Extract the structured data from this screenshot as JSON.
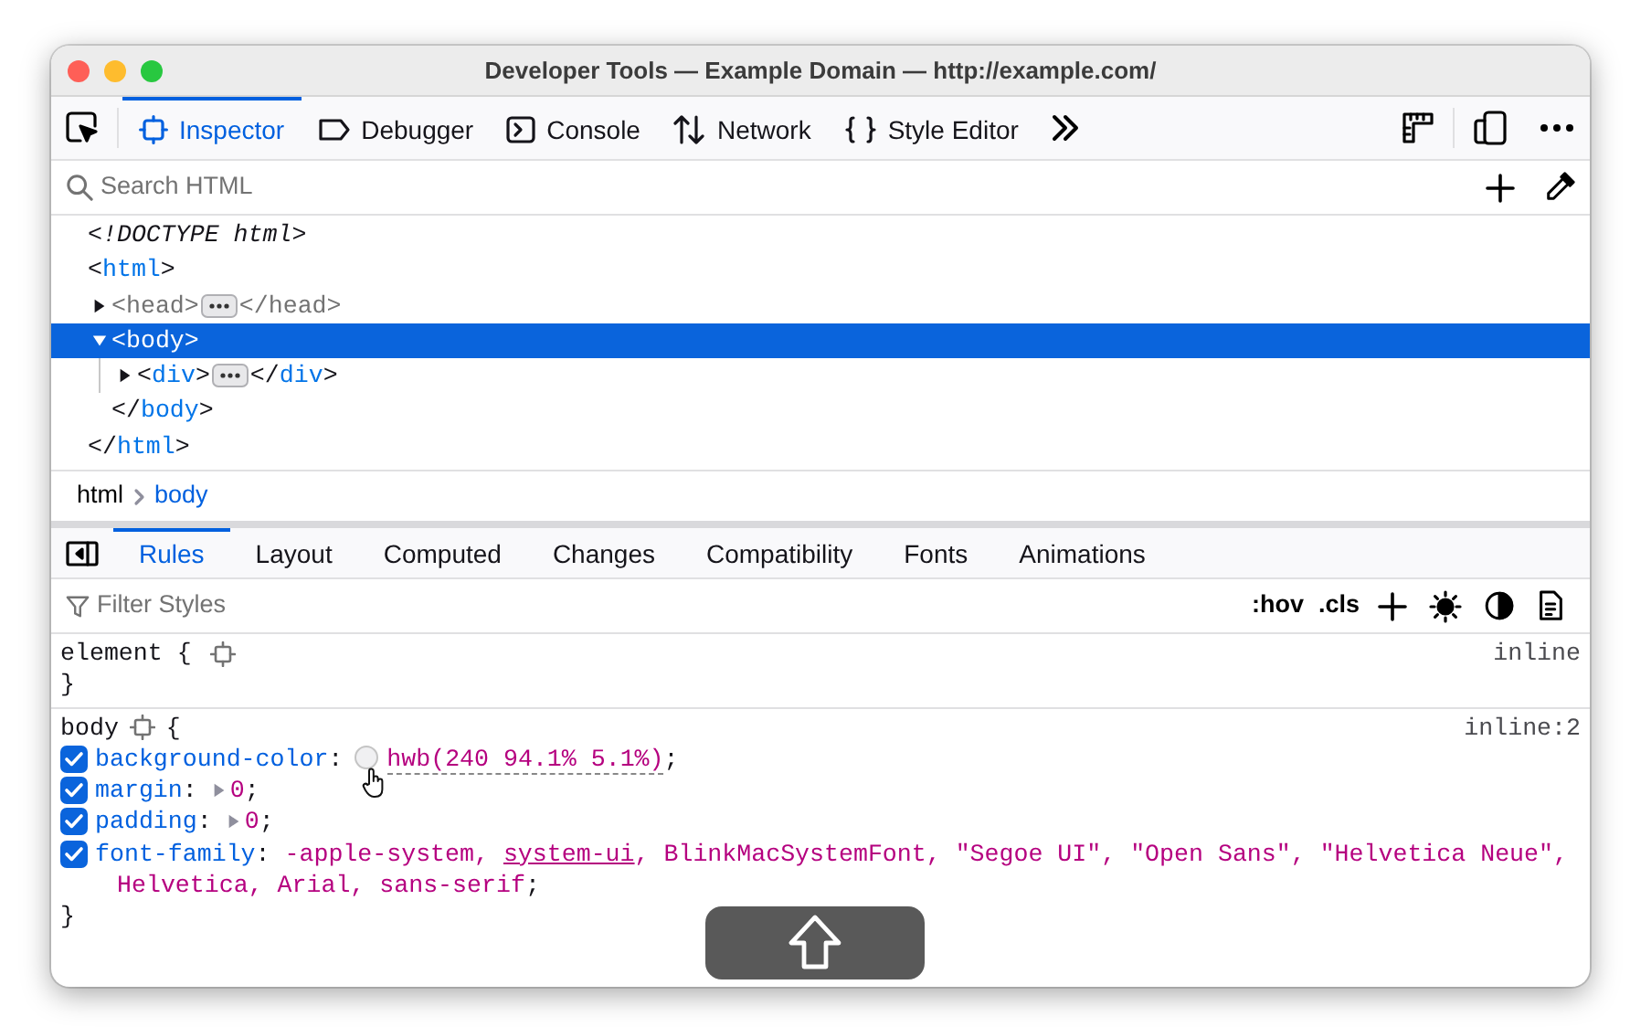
{
  "window": {
    "title": "Developer Tools — Example Domain — http://example.com/"
  },
  "toolbar": {
    "tabs": [
      {
        "kind": "inspector",
        "label": "Inspector",
        "selected": true
      },
      {
        "kind": "debugger",
        "label": "Debugger",
        "selected": false
      },
      {
        "kind": "console",
        "label": "Console",
        "selected": false
      },
      {
        "kind": "network",
        "label": "Network",
        "selected": false
      },
      {
        "kind": "style-editor",
        "label": "Style Editor",
        "selected": false
      }
    ]
  },
  "search": {
    "placeholder": "Search HTML"
  },
  "markup": {
    "nodes": [
      {
        "kind": "doctype",
        "text": "<!DOCTYPE html>"
      },
      {
        "kind": "element",
        "open": [
          "<",
          "html",
          ">"
        ],
        "close": [
          "</",
          "html",
          ">"
        ],
        "collapsible": false,
        "expanded": true,
        "selected": false,
        "dimmed": false,
        "children": [
          {
            "kind": "element",
            "open": [
              "<",
              "head",
              ">"
            ],
            "close": [
              "</",
              "head",
              ">"
            ],
            "collapsible": true,
            "expanded": false,
            "selected": false,
            "dimmed": true
          },
          {
            "kind": "element",
            "open": [
              "<",
              "body",
              ">"
            ],
            "close": [
              "</",
              "body",
              ">"
            ],
            "collapsible": true,
            "expanded": true,
            "selected": true,
            "dimmed": false,
            "children": [
              {
                "kind": "element",
                "open": [
                  "<",
                  "div",
                  ">"
                ],
                "close": [
                  "</",
                  "div",
                  ">"
                ],
                "collapsible": true,
                "expanded": false,
                "selected": false,
                "dimmed": false
              }
            ]
          }
        ]
      }
    ]
  },
  "breadcrumbs": [
    {
      "label": "html",
      "selected": false
    },
    {
      "label": "body",
      "selected": true
    }
  ],
  "sidebar_tabs": [
    {
      "label": "Rules",
      "selected": true
    },
    {
      "label": "Layout",
      "selected": false
    },
    {
      "label": "Computed",
      "selected": false
    },
    {
      "label": "Changes",
      "selected": false
    },
    {
      "label": "Compatibility",
      "selected": false
    },
    {
      "label": "Fonts",
      "selected": false
    },
    {
      "label": "Animations",
      "selected": false
    }
  ],
  "filter": {
    "placeholder": "Filter Styles",
    "buttons": [
      ":hov",
      ".cls"
    ]
  },
  "rules": [
    {
      "selector": "element {",
      "close_brace": "}",
      "source": "inline"
    },
    {
      "selector": "body",
      "open_brace": "{",
      "close_brace": "}",
      "source": "inline:2",
      "declarations": [
        {
          "kind": "color",
          "enabled": true,
          "name": "background-color",
          "sep": ":",
          "color": "#f0f0f2",
          "parts": [
            {
              "text": "hwb(240 94.1% 5.1%)",
              "underlined": false
            }
          ],
          "end": ";"
        },
        {
          "kind": "expandable",
          "enabled": true,
          "name": "margin",
          "sep": ":",
          "parts": [
            {
              "text": "0",
              "underlined": false
            }
          ],
          "end": ";"
        },
        {
          "kind": "expandable",
          "enabled": true,
          "name": "padding",
          "sep": ":",
          "parts": [
            {
              "text": "0",
              "underlined": false
            }
          ],
          "end": ";"
        },
        {
          "kind": "plain",
          "enabled": true,
          "name": "font-family",
          "sep": ":",
          "parts": [
            {
              "text": "-apple-system, ",
              "underlined": false
            },
            {
              "text": "system-ui",
              "underlined": true
            },
            {
              "text": ", BlinkMacSystemFont, \"Segoe UI\", \"Open Sans\", \"Helvetica Neue\", Helvetica, Arial, sans-serif",
              "underlined": false
            }
          ],
          "end": ";"
        }
      ]
    }
  ]
}
